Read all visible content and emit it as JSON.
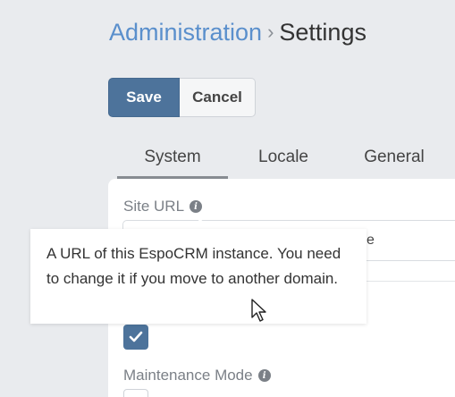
{
  "breadcrumb": {
    "parent": "Administration",
    "separator": "›",
    "current": "Settings"
  },
  "toolbar": {
    "save_label": "Save",
    "cancel_label": "Cancel"
  },
  "tabs": [
    {
      "label": "System"
    },
    {
      "label": "Locale"
    },
    {
      "label": "General"
    }
  ],
  "fields": {
    "site_url": {
      "label": "Site URL",
      "value_fragment": "e"
    },
    "maintenance_mode": {
      "label": "Maintenance Mode",
      "checked": false
    }
  },
  "checkbox_above": {
    "checked": true
  },
  "tooltip": {
    "text": "A URL of this EspoCRM instance. You need to change it if you move to another domain."
  },
  "colors": {
    "primary": "#4d739b",
    "link": "#5a8fcc",
    "background": "#e9ebee"
  },
  "icons": [
    "info-icon",
    "check-icon",
    "mouse-cursor-icon"
  ]
}
